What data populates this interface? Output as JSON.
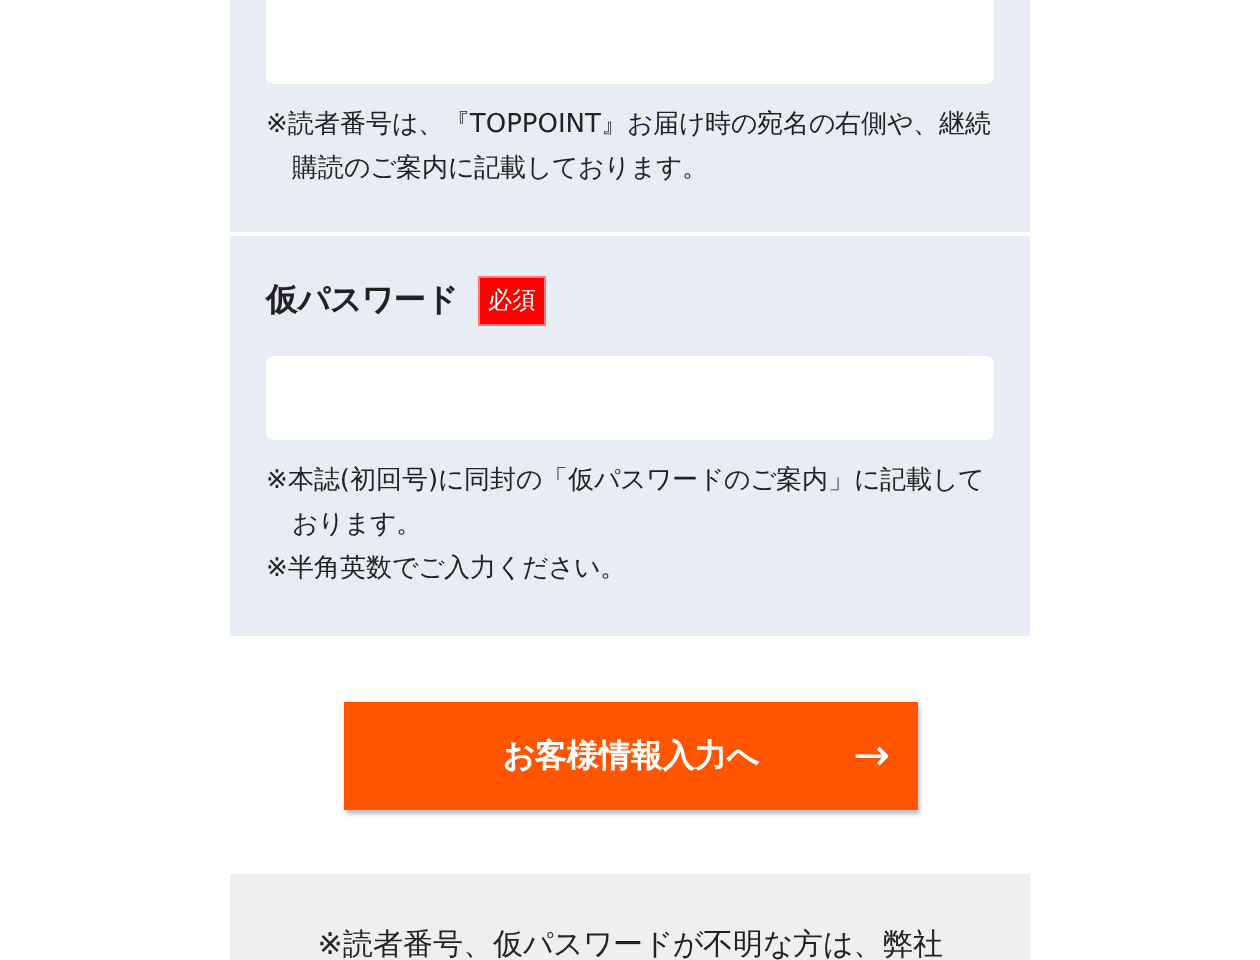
{
  "fields": [
    {
      "notes": [
        "※読者番号は、『TOPPOINT』お届け時の宛名の右側や、継続購読のご案内に記載しております。"
      ]
    },
    {
      "label": "仮パスワード",
      "required_badge": "必須",
      "notes": [
        "※本誌(初回号)に同封の「仮パスワードのご案内」に記載しております。",
        "※半角英数でご入力ください。"
      ]
    }
  ],
  "submit_button": {
    "label": "お客様情報入力へ",
    "arrow": "→"
  },
  "footer_note": "※読者番号、仮パスワードが不明な方は、弊社"
}
